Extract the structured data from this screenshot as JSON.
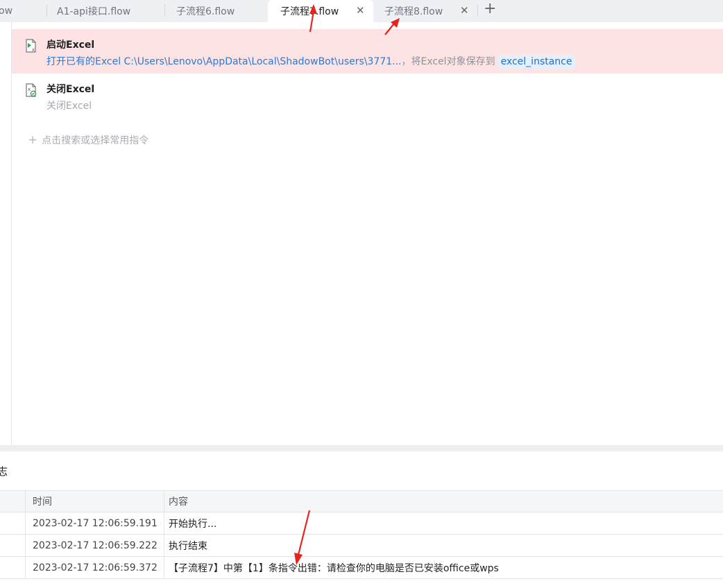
{
  "tabs": [
    {
      "label": "ow",
      "active": false
    },
    {
      "label": "A1-api接口.flow",
      "active": false
    },
    {
      "label": "子流程6.flow",
      "active": false
    },
    {
      "label": "子流程7.flow",
      "active": true
    },
    {
      "label": "子流程8.flow",
      "active": false
    }
  ],
  "commands": [
    {
      "title": "启动Excel",
      "desc_path": "打开已有的Excel C:\\Users\\Lenovo\\AppData\\Local\\ShadowBot\\users\\3771...",
      "desc_sep": "，",
      "desc_saveto": "将Excel对象保存到",
      "desc_var": "excel_instance",
      "icon": "excel-launch-icon",
      "status": "error"
    },
    {
      "title": "关闭Excel",
      "desc": "关闭Excel",
      "icon": "excel-close-icon",
      "status": "normal"
    }
  ],
  "add_command_placeholder": "点击搜索或选择常用指令",
  "log": {
    "title": "志",
    "columns": {
      "time": "时间",
      "content": "内容"
    },
    "rows": [
      {
        "time": "2023-02-17 12:06:59.191",
        "content": "开始执行..."
      },
      {
        "time": "2023-02-17 12:06:59.222",
        "content": "执行结束"
      },
      {
        "time": "2023-02-17 12:06:59.372",
        "content": "【子流程7】中第【1】条指令出错：请检查你的电脑是否已安装office或wps"
      }
    ]
  },
  "colors": {
    "error_row_bg": "#fde3e3",
    "link_blue": "#2a7ad6",
    "annotation_red": "#e8231c"
  }
}
